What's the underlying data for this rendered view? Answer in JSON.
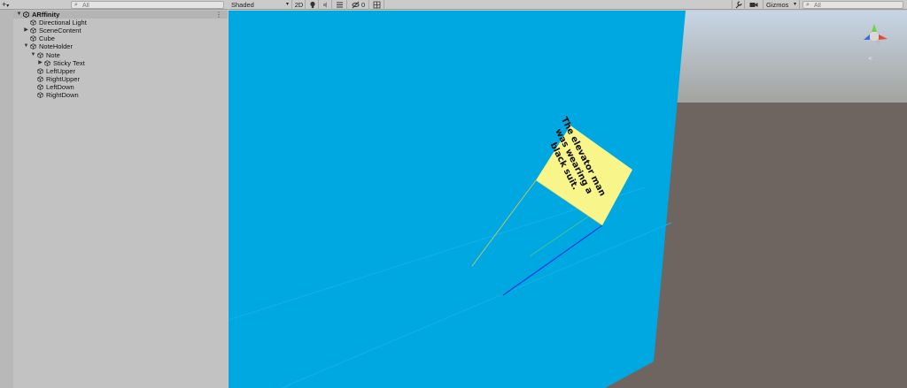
{
  "hierarchy": {
    "add_label": "+",
    "add_arrow": "▾",
    "search_placeholder": "All",
    "scene_menu": "⋮",
    "items": [
      {
        "label": "ARffinity",
        "depth": 0,
        "expanded": true,
        "is_scene": true
      },
      {
        "label": "Directional Light",
        "depth": 1,
        "expanded": null
      },
      {
        "label": "SceneContent",
        "depth": 1,
        "expanded": false
      },
      {
        "label": "Cube",
        "depth": 1,
        "expanded": null
      },
      {
        "label": "NoteHolder",
        "depth": 1,
        "expanded": true
      },
      {
        "label": "Note",
        "depth": 2,
        "expanded": true
      },
      {
        "label": "Sticky Text",
        "depth": 3,
        "expanded": false
      },
      {
        "label": "LeftUpper",
        "depth": 2,
        "expanded": null
      },
      {
        "label": "RightUpper",
        "depth": 2,
        "expanded": null
      },
      {
        "label": "LeftDown",
        "depth": 2,
        "expanded": null
      },
      {
        "label": "RightDown",
        "depth": 2,
        "expanded": null
      }
    ]
  },
  "scene_toolbar": {
    "shading_mode": "Shaded",
    "shading_arrow": "▾",
    "mode_2d": "2D",
    "lighting_icon": "lightbulb-icon",
    "audio_icon": "speaker-icon",
    "effects_icon": "effects-icon",
    "hidden_count": "0",
    "tools_icon": "wrench-icon",
    "camera_icon": "camera-icon",
    "gizmos_label": "Gizmos",
    "search_placeholder": "All"
  },
  "scene": {
    "note_text": "The elevator man was wearing a black suit.",
    "colors": {
      "cube": "#00a8e2",
      "note": "#f8f58a",
      "sky_top": "#c8d8e8",
      "horizon": "#a3a39e",
      "ground": "#6e6560"
    }
  }
}
